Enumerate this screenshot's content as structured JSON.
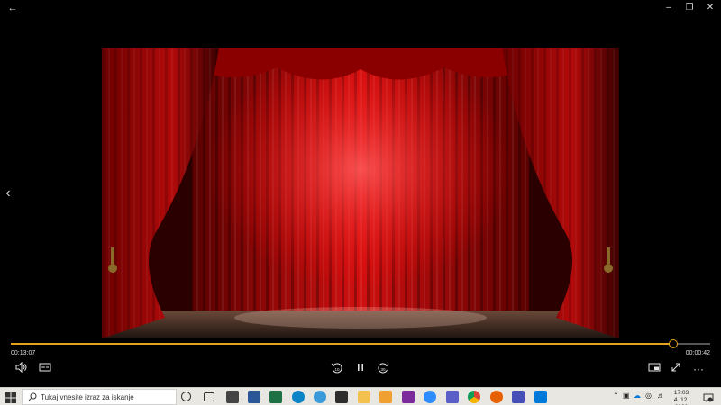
{
  "window": {
    "back_icon": "arrow-left-icon",
    "minimize_icon": "minimize-icon",
    "maximize_icon": "maximize-icon",
    "close_icon": "close-icon"
  },
  "video": {
    "scene": "red theater curtain stage",
    "prev_icon": "chevron-left-icon"
  },
  "player": {
    "time_elapsed": "00:13:07",
    "time_remaining": "00:00:42",
    "progress_fraction": 0.947,
    "accent_color": "#e6a21b",
    "volume_icon": "volume-icon",
    "subtitles_icon": "subtitles-icon",
    "rewind_icon": "skip-back-10-icon",
    "pause_icon": "pause-icon",
    "forward_icon": "skip-forward-30-icon",
    "miniview_icon": "mini-view-icon",
    "fullscreen_icon": "fullscreen-icon",
    "more_icon": "more-icon"
  },
  "taskbar": {
    "search_placeholder": "Tukaj vnesite izraz za iskanje",
    "clock_time": "17:03",
    "clock_date": "4. 12. 2020",
    "apps": [
      "cortana",
      "task-view",
      "store",
      "word",
      "excel",
      "edge",
      "chrome-like",
      "sticky-notes",
      "file-explorer",
      "photos",
      "onenote",
      "zoom",
      "teams",
      "chrome",
      "firefox",
      "teams-2",
      "movies-tv"
    ]
  }
}
